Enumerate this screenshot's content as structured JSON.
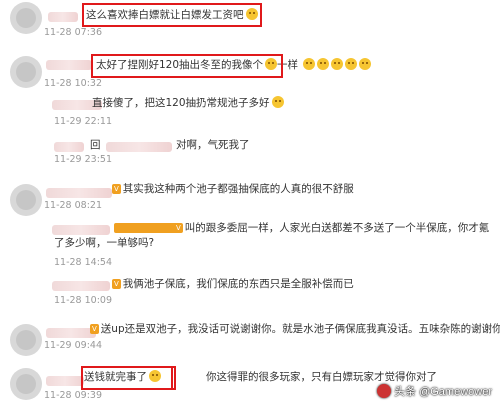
{
  "comments": [
    {
      "text": "这么喜欢捧白嫖就让白嫖发工资吧",
      "time": "11-28 07:36"
    },
    {
      "text": "太好了捏刚好120抽出冬至的我像个",
      "text2": "一样",
      "time": "11-28 10:32"
    },
    {
      "text": "直接傻了，把这120抽扔常规池子多好",
      "time": "11-29 22:11"
    },
    {
      "text": "回",
      "text2": "对啊，气死我了",
      "time": "11-29 23:51"
    },
    {
      "text": "其实我这种两个池子都强抽保底的人真的很不舒服",
      "time": "11-28 08:21"
    },
    {
      "text": "叫的跟多委屈一样，人家光白送都差不多送了一个半保底，你才氪了多少啊，一单够吗?",
      "time": "11-28 14:54"
    },
    {
      "text": "我俩池子保底，我们保底的东西只是全服补偿而已",
      "time": "11-28 10:09"
    },
    {
      "text": "送up还是双池子，我没话可说谢谢你。就是水池子俩保底我真没话。五味杂陈的谢谢你",
      "time": "11-29 09:44"
    },
    {
      "text": "送钱就完事了",
      "text2": "你这得罪的很多玩家，只有白嫖玩家才觉得你对了",
      "time": "11-28 09:39"
    }
  ],
  "watermark": "头条 @Gamewower"
}
